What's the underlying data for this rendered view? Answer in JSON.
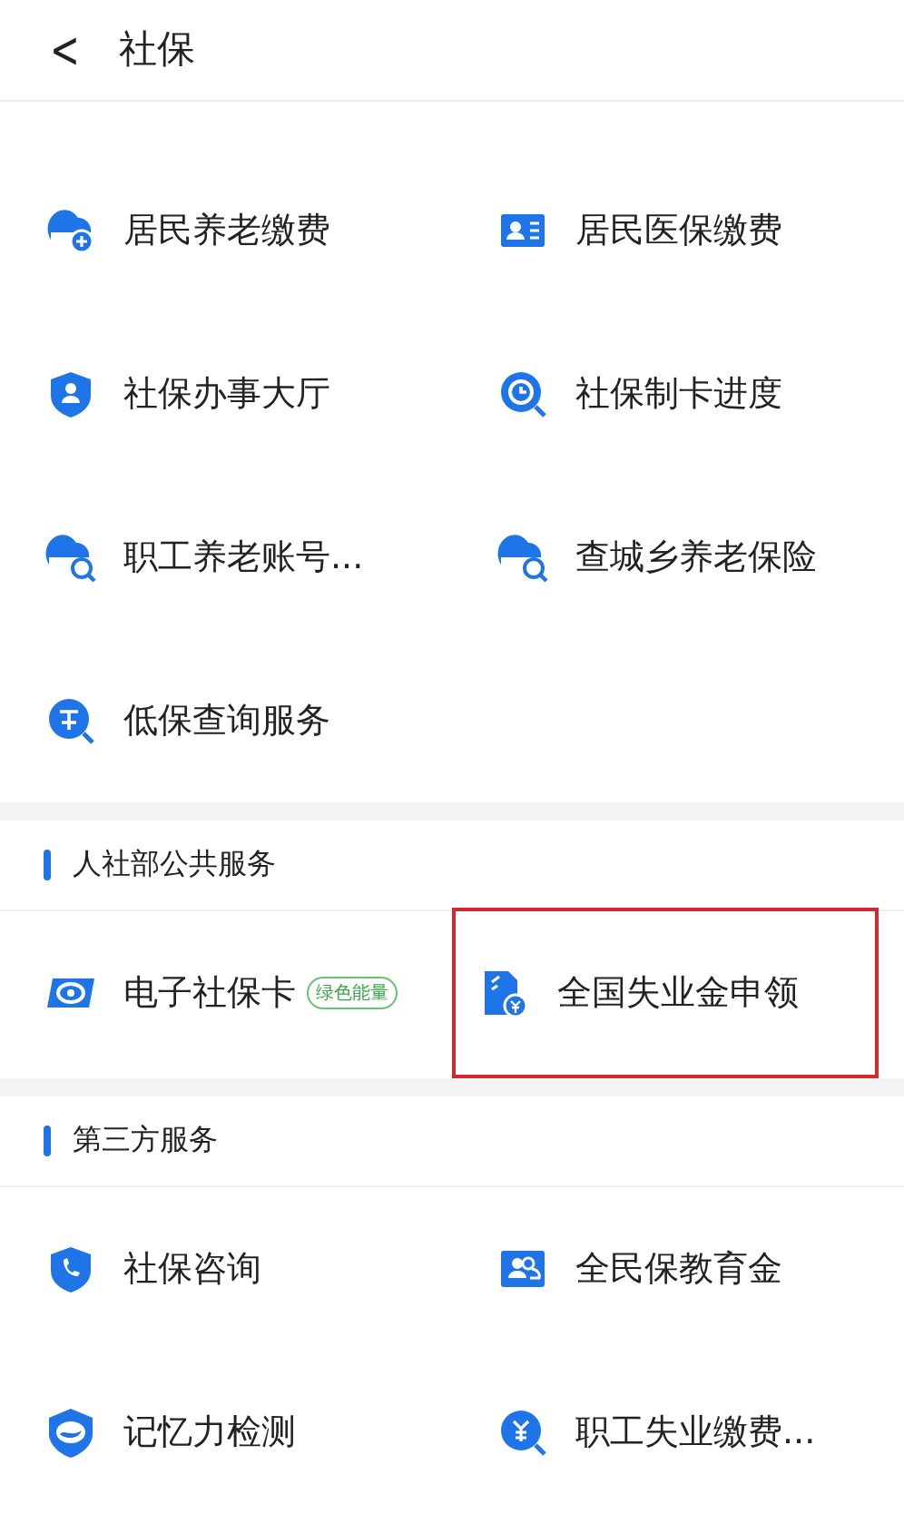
{
  "header": {
    "back": "<",
    "title": "社保"
  },
  "sections": [
    {
      "items": [
        {
          "label": "居民养老缴费",
          "kind": "cloud-plus",
          "highlighted": false
        },
        {
          "label": "居民医保缴费",
          "kind": "id-card",
          "highlighted": false
        },
        {
          "label": "社保办事大厅",
          "kind": "shield-person",
          "highlighted": false
        },
        {
          "label": "社保制卡进度",
          "kind": "clock-search",
          "highlighted": false
        },
        {
          "label": "职工养老账号...",
          "kind": "cloud-search",
          "highlighted": false
        },
        {
          "label": "查城乡养老保险",
          "kind": "cloud-search",
          "highlighted": false
        },
        {
          "label": "低保查询服务",
          "kind": "circle-search",
          "highlighted": false
        }
      ]
    },
    {
      "title": "人社部公共服务",
      "items": [
        {
          "label": "电子社保卡",
          "badge": "绿色能量",
          "kind": "card-logo",
          "highlighted": false
        },
        {
          "label": "全国失业金申领",
          "kind": "document-coin",
          "highlighted": true
        }
      ]
    },
    {
      "title": "第三方服务",
      "items": [
        {
          "label": "社保咨询",
          "kind": "shield-phone",
          "highlighted": false
        },
        {
          "label": "全民保教育金",
          "kind": "people-card",
          "highlighted": false
        },
        {
          "label": "记忆力检测",
          "kind": "shield-wave",
          "highlighted": false
        },
        {
          "label": "职工失业缴费...",
          "kind": "coin-search",
          "highlighted": false
        }
      ]
    }
  ]
}
